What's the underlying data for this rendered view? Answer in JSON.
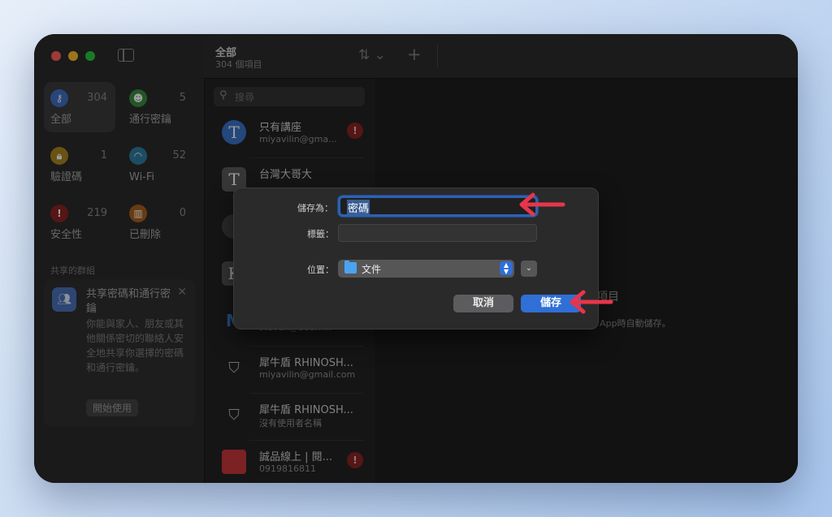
{
  "header": {
    "title": "全部",
    "subtitle": "304 個項目"
  },
  "sidebar": {
    "categories": [
      {
        "label": "全部",
        "count": "304",
        "icon": "key-icon",
        "color": "#3f70c4"
      },
      {
        "label": "通行密鑰",
        "count": "5",
        "icon": "person-key-icon",
        "color": "#3a8a3f"
      },
      {
        "label": "驗證碼",
        "count": "1",
        "icon": "lock-icon",
        "color": "#a8871f"
      },
      {
        "label": "Wi-Fi",
        "count": "52",
        "icon": "wifi-icon",
        "color": "#2f7d9e"
      },
      {
        "label": "安全性",
        "count": "219",
        "icon": "exclamation-icon",
        "color": "#8a2422"
      },
      {
        "label": "已刪除",
        "count": "0",
        "icon": "trash-icon",
        "color": "#a8601e"
      }
    ],
    "groups_title": "共享的群組",
    "share_card": {
      "title": "共享密碼和通行密鑰",
      "body": "你能與家人、朋友或其他關係密切的聯絡人安全地共享你選擇的密碼和通行密鑰。",
      "button": "開始使用"
    }
  },
  "search": {
    "placeholder": "搜尋"
  },
  "list": [
    {
      "title": "只有講座",
      "subtitle": "miyavilin@gma...",
      "alert": true,
      "icon_letter": "T",
      "icon_color": "#3b73c9"
    },
    {
      "title": "台灣大哥大",
      "subtitle": "",
      "alert": false,
      "icon_letter": "T",
      "icon_color": "#5a5a5a"
    },
    {
      "title": "",
      "subtitle": "",
      "alert": false,
      "icon_letter": "",
      "icon_color": "#444"
    },
    {
      "title": "",
      "subtitle": "",
      "alert": false,
      "icon_letter": "K",
      "icon_color": "#555"
    },
    {
      "title": "",
      "subtitle": "steven@boom...",
      "alert": true,
      "icon_letter": "M",
      "icon_color": "transparent"
    },
    {
      "title": "犀牛盾 RHINOSH...",
      "subtitle": "miyavilin@gmail.com",
      "alert": false,
      "icon_letter": "",
      "icon_color": "#2a2a2a"
    },
    {
      "title": "犀牛盾 RHINOSH...",
      "subtitle": "沒有使用者名稱",
      "alert": false,
      "icon_letter": "",
      "icon_color": "#2a2a2a"
    },
    {
      "title": "誠品線上 | 閱...",
      "subtitle": "0919816811",
      "alert": true,
      "icon_letter": "",
      "icon_color": "#c9363a"
    }
  ],
  "detail": {
    "title_fragment": "項目",
    "subtitle_fragment": "App時自動儲存。"
  },
  "dialog": {
    "save_as_label": "儲存為：",
    "save_as_value": "密碼",
    "tags_label": "標籤：",
    "location_label": "位置：",
    "location_value": "文件",
    "cancel_label": "取消",
    "save_label": "儲存"
  },
  "annotations": {
    "arrow_color": "#e8354a"
  }
}
